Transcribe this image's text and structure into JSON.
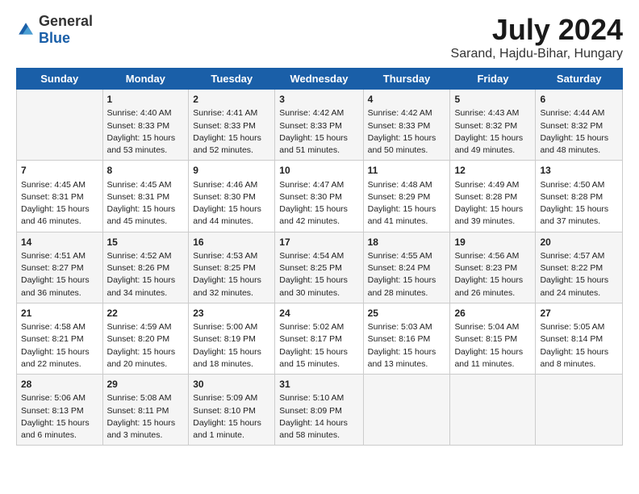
{
  "logo": {
    "general": "General",
    "blue": "Blue"
  },
  "title": "July 2024",
  "subtitle": "Sarand, Hajdu-Bihar, Hungary",
  "days_header": [
    "Sunday",
    "Monday",
    "Tuesday",
    "Wednesday",
    "Thursday",
    "Friday",
    "Saturday"
  ],
  "weeks": [
    [
      {
        "day": "",
        "content": ""
      },
      {
        "day": "1",
        "content": "Sunrise: 4:40 AM\nSunset: 8:33 PM\nDaylight: 15 hours\nand 53 minutes."
      },
      {
        "day": "2",
        "content": "Sunrise: 4:41 AM\nSunset: 8:33 PM\nDaylight: 15 hours\nand 52 minutes."
      },
      {
        "day": "3",
        "content": "Sunrise: 4:42 AM\nSunset: 8:33 PM\nDaylight: 15 hours\nand 51 minutes."
      },
      {
        "day": "4",
        "content": "Sunrise: 4:42 AM\nSunset: 8:33 PM\nDaylight: 15 hours\nand 50 minutes."
      },
      {
        "day": "5",
        "content": "Sunrise: 4:43 AM\nSunset: 8:32 PM\nDaylight: 15 hours\nand 49 minutes."
      },
      {
        "day": "6",
        "content": "Sunrise: 4:44 AM\nSunset: 8:32 PM\nDaylight: 15 hours\nand 48 minutes."
      }
    ],
    [
      {
        "day": "7",
        "content": "Sunrise: 4:45 AM\nSunset: 8:31 PM\nDaylight: 15 hours\nand 46 minutes."
      },
      {
        "day": "8",
        "content": "Sunrise: 4:45 AM\nSunset: 8:31 PM\nDaylight: 15 hours\nand 45 minutes."
      },
      {
        "day": "9",
        "content": "Sunrise: 4:46 AM\nSunset: 8:30 PM\nDaylight: 15 hours\nand 44 minutes."
      },
      {
        "day": "10",
        "content": "Sunrise: 4:47 AM\nSunset: 8:30 PM\nDaylight: 15 hours\nand 42 minutes."
      },
      {
        "day": "11",
        "content": "Sunrise: 4:48 AM\nSunset: 8:29 PM\nDaylight: 15 hours\nand 41 minutes."
      },
      {
        "day": "12",
        "content": "Sunrise: 4:49 AM\nSunset: 8:28 PM\nDaylight: 15 hours\nand 39 minutes."
      },
      {
        "day": "13",
        "content": "Sunrise: 4:50 AM\nSunset: 8:28 PM\nDaylight: 15 hours\nand 37 minutes."
      }
    ],
    [
      {
        "day": "14",
        "content": "Sunrise: 4:51 AM\nSunset: 8:27 PM\nDaylight: 15 hours\nand 36 minutes."
      },
      {
        "day": "15",
        "content": "Sunrise: 4:52 AM\nSunset: 8:26 PM\nDaylight: 15 hours\nand 34 minutes."
      },
      {
        "day": "16",
        "content": "Sunrise: 4:53 AM\nSunset: 8:25 PM\nDaylight: 15 hours\nand 32 minutes."
      },
      {
        "day": "17",
        "content": "Sunrise: 4:54 AM\nSunset: 8:25 PM\nDaylight: 15 hours\nand 30 minutes."
      },
      {
        "day": "18",
        "content": "Sunrise: 4:55 AM\nSunset: 8:24 PM\nDaylight: 15 hours\nand 28 minutes."
      },
      {
        "day": "19",
        "content": "Sunrise: 4:56 AM\nSunset: 8:23 PM\nDaylight: 15 hours\nand 26 minutes."
      },
      {
        "day": "20",
        "content": "Sunrise: 4:57 AM\nSunset: 8:22 PM\nDaylight: 15 hours\nand 24 minutes."
      }
    ],
    [
      {
        "day": "21",
        "content": "Sunrise: 4:58 AM\nSunset: 8:21 PM\nDaylight: 15 hours\nand 22 minutes."
      },
      {
        "day": "22",
        "content": "Sunrise: 4:59 AM\nSunset: 8:20 PM\nDaylight: 15 hours\nand 20 minutes."
      },
      {
        "day": "23",
        "content": "Sunrise: 5:00 AM\nSunset: 8:19 PM\nDaylight: 15 hours\nand 18 minutes."
      },
      {
        "day": "24",
        "content": "Sunrise: 5:02 AM\nSunset: 8:17 PM\nDaylight: 15 hours\nand 15 minutes."
      },
      {
        "day": "25",
        "content": "Sunrise: 5:03 AM\nSunset: 8:16 PM\nDaylight: 15 hours\nand 13 minutes."
      },
      {
        "day": "26",
        "content": "Sunrise: 5:04 AM\nSunset: 8:15 PM\nDaylight: 15 hours\nand 11 minutes."
      },
      {
        "day": "27",
        "content": "Sunrise: 5:05 AM\nSunset: 8:14 PM\nDaylight: 15 hours\nand 8 minutes."
      }
    ],
    [
      {
        "day": "28",
        "content": "Sunrise: 5:06 AM\nSunset: 8:13 PM\nDaylight: 15 hours\nand 6 minutes."
      },
      {
        "day": "29",
        "content": "Sunrise: 5:08 AM\nSunset: 8:11 PM\nDaylight: 15 hours\nand 3 minutes."
      },
      {
        "day": "30",
        "content": "Sunrise: 5:09 AM\nSunset: 8:10 PM\nDaylight: 15 hours\nand 1 minute."
      },
      {
        "day": "31",
        "content": "Sunrise: 5:10 AM\nSunset: 8:09 PM\nDaylight: 14 hours\nand 58 minutes."
      },
      {
        "day": "",
        "content": ""
      },
      {
        "day": "",
        "content": ""
      },
      {
        "day": "",
        "content": ""
      }
    ]
  ]
}
